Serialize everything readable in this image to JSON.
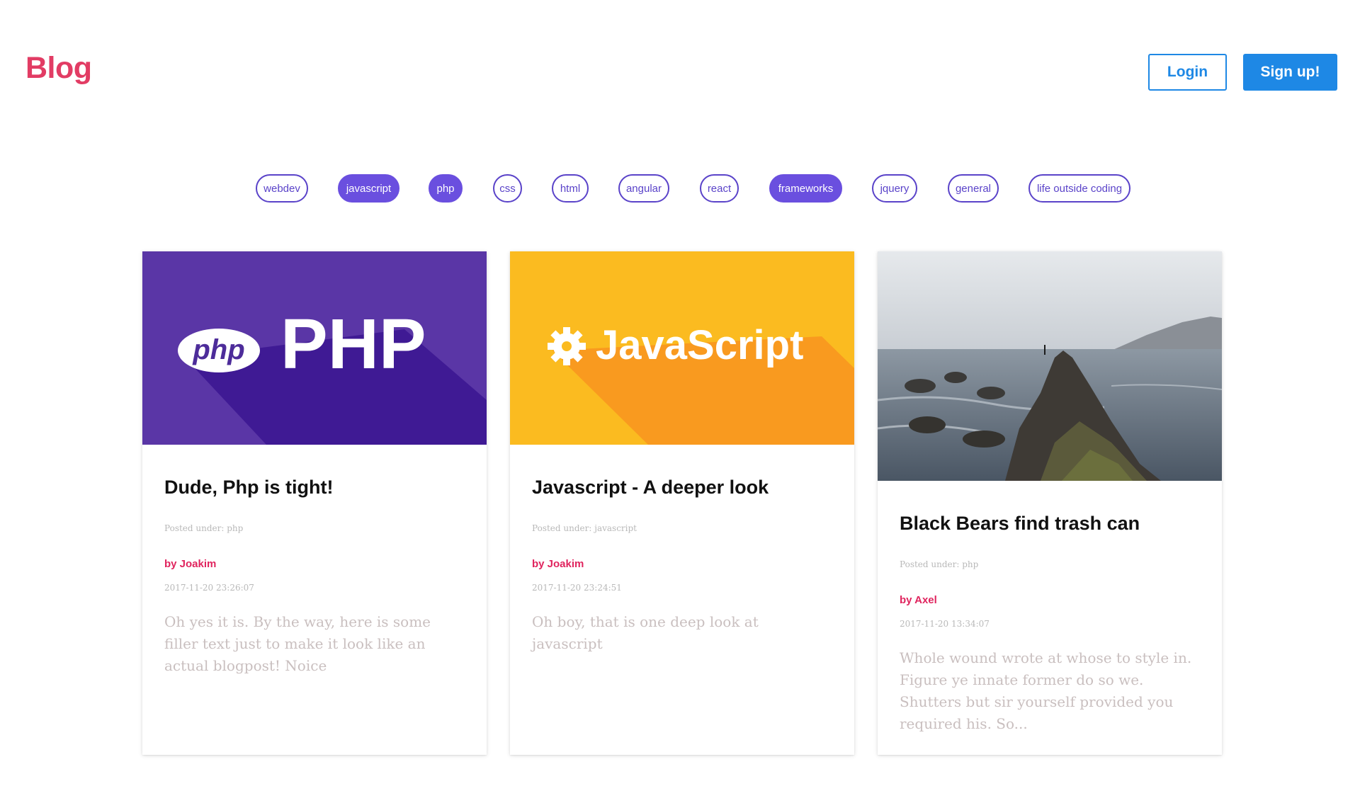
{
  "header": {
    "brand": "Blog",
    "login_label": "Login",
    "signup_label": "Sign up!"
  },
  "tags": [
    {
      "label": "webdev",
      "active": false
    },
    {
      "label": "javascript",
      "active": true
    },
    {
      "label": "php",
      "active": true
    },
    {
      "label": "css",
      "active": false
    },
    {
      "label": "html",
      "active": false
    },
    {
      "label": "angular",
      "active": false
    },
    {
      "label": "react",
      "active": false
    },
    {
      "label": "frameworks",
      "active": true
    },
    {
      "label": "jquery",
      "active": false
    },
    {
      "label": "general",
      "active": false
    },
    {
      "label": "life outside coding",
      "active": false
    }
  ],
  "posts": [
    {
      "image_text": "PHP",
      "image_logo": "php",
      "title": "Dude, Php is tight!",
      "category": "Posted under: php",
      "author": "by Joakim",
      "date": "2017-11-20 23:26:07",
      "excerpt": "Oh yes it is. By the way, here is some filler text just to make it look like an actual blogpost! Noice"
    },
    {
      "image_text": "JavaScript",
      "title": "Javascript - A deeper look",
      "category": "Posted under: javascript",
      "author": "by Joakim",
      "date": "2017-11-20 23:24:51",
      "excerpt": "Oh boy, that is one deep look at javascript"
    },
    {
      "title": "Black Bears find trash can",
      "category": "Posted under: php",
      "author": "by Axel",
      "date": "2017-11-20 13:34:07",
      "excerpt": "Whole wound wrote at whose to style in. Figure ye innate former do so we. Shutters but sir yourself provided you required his. So..."
    }
  ],
  "colors": {
    "brand": "#e23c64",
    "primary": "#1e88e5",
    "tag": "#5a43c9",
    "tag_active": "#6a4fdf",
    "author": "#e0245e",
    "php_bg": "#5a36a6",
    "js_bg": "#fbbb20"
  }
}
